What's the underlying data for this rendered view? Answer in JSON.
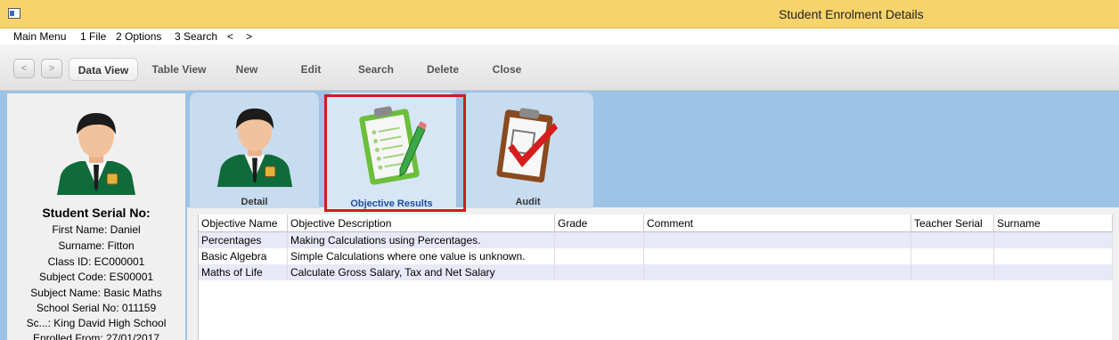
{
  "window": {
    "title": "Student Enrolment Details"
  },
  "menu": [
    "Main Menu",
    "1 File",
    "2 Options",
    "3 Search",
    "<",
    ">"
  ],
  "toolbar": {
    "back": "<",
    "forward": ">",
    "buttons": [
      "Data View",
      "Table View",
      "New",
      "Edit",
      "Search",
      "Delete",
      "Close"
    ]
  },
  "student": {
    "heading": "Student Serial No:",
    "fields": [
      "First Name: Daniel",
      "Surname: Fitton",
      "Class ID: EC000001",
      "Subject Code: ES00001",
      "Subject Name: Basic Maths",
      "School Serial No: 011159",
      "Sc...: King David High School",
      "Enrolled From: 27/01/2017"
    ]
  },
  "tabs": [
    {
      "label": "Detail",
      "icon": "student-avatar-icon"
    },
    {
      "label": "Objective Results",
      "icon": "checklist-clipboard-icon"
    },
    {
      "label": "Audit",
      "icon": "audit-clipboard-icon"
    }
  ],
  "grid": {
    "columns": [
      "Objective Name",
      "Objective Description",
      "Grade",
      "Comment",
      "Teacher Serial",
      "Surname"
    ],
    "rows": [
      [
        "Percentages",
        "Making Calculations using Percentages.",
        "",
        "",
        "",
        ""
      ],
      [
        "Basic Algebra",
        "Simple Calculations where one value is unknown.",
        "",
        "",
        "",
        ""
      ],
      [
        "Maths of Life",
        "Calculate Gross Salary, Tax and Net Salary",
        "",
        "",
        "",
        ""
      ]
    ]
  },
  "colors": {
    "titlebar": "#f7d36b",
    "panel": "#9dc3e6",
    "selection-border": "#d41a1a",
    "row-alt": "#e8e8f8"
  }
}
